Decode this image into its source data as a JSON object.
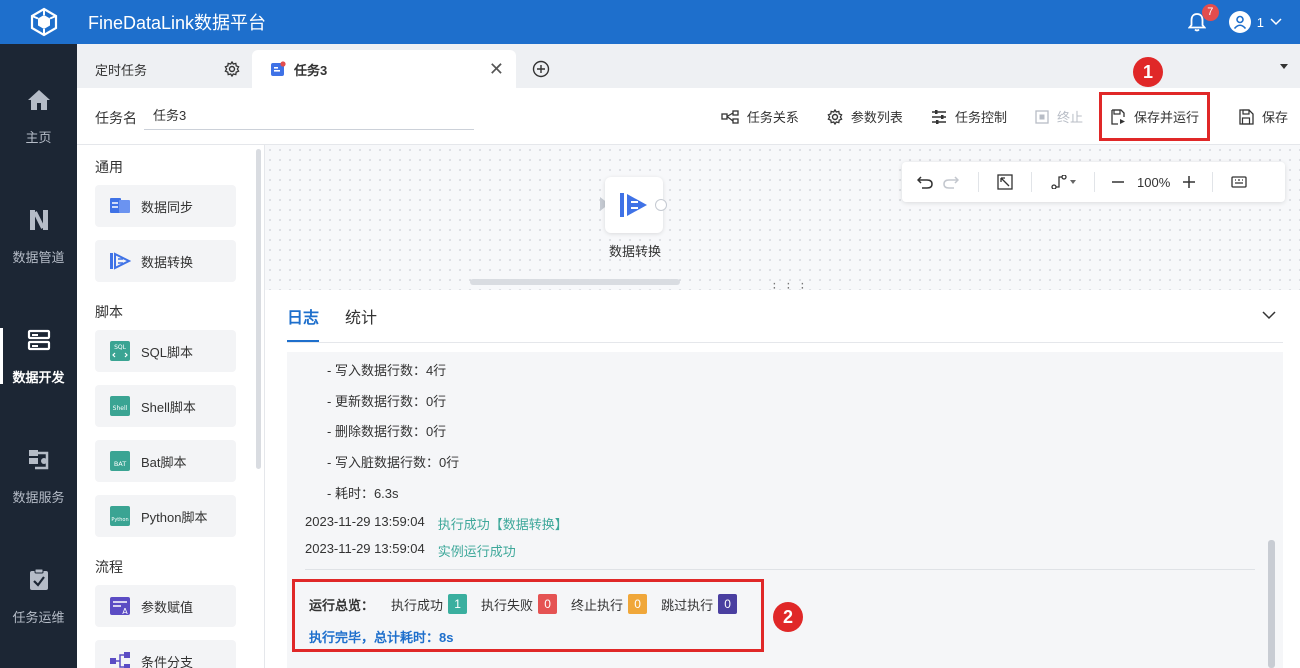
{
  "app": {
    "title": "FineDataLink数据平台"
  },
  "header": {
    "notifications_count": "7",
    "user_name": "1"
  },
  "sidebar": {
    "items": [
      {
        "label": "主页",
        "icon": "home-icon",
        "active": false
      },
      {
        "label": "数据管道",
        "icon": "pipeline-icon",
        "active": false
      },
      {
        "label": "数据开发",
        "icon": "dev-icon",
        "active": true
      },
      {
        "label": "数据服务",
        "icon": "service-icon",
        "active": false
      },
      {
        "label": "任务运维",
        "icon": "ops-icon",
        "active": false
      }
    ]
  },
  "tabs": [
    {
      "label": "定时任务",
      "icon": "gear-icon"
    },
    {
      "label": "任务3",
      "icon": "task-icon",
      "active": true
    }
  ],
  "task": {
    "label": "任务名",
    "name": "任务3"
  },
  "toolbar": {
    "relation": "任务关系",
    "params": "参数列表",
    "control": "任务控制",
    "stop": "终止",
    "save_run": "保存并运行",
    "save": "保存"
  },
  "components": {
    "groups": [
      {
        "title": "通用",
        "items": [
          "数据同步",
          "数据转换"
        ]
      },
      {
        "title": "脚本",
        "items": [
          "SQL脚本",
          "Shell脚本",
          "Bat脚本",
          "Python脚本"
        ]
      },
      {
        "title": "流程",
        "items": [
          "参数赋值",
          "条件分支"
        ]
      }
    ]
  },
  "canvas": {
    "node_label": "数据转换",
    "zoom": "100%"
  },
  "log": {
    "tabs": [
      "日志",
      "统计"
    ],
    "stats": [
      "- 写入数据行数：4行",
      "- 更新数据行数：0行",
      "- 删除数据行数：0行",
      "- 写入脏数据行数：0行",
      "- 耗时：6.3s"
    ],
    "lines": [
      {
        "time": "2023-11-29 13:59:04",
        "msg": "执行成功【数据转换】"
      },
      {
        "time": "2023-11-29 13:59:04",
        "msg": "实例运行成功"
      }
    ],
    "summary": {
      "title": "运行总览：",
      "items": [
        {
          "label": "执行成功",
          "count": "1",
          "color": "#3aaf9f"
        },
        {
          "label": "执行失败",
          "count": "0",
          "color": "#e55353"
        },
        {
          "label": "终止执行",
          "count": "0",
          "color": "#f0a73a"
        },
        {
          "label": "跳过执行",
          "count": "0",
          "color": "#4a3fa0"
        }
      ],
      "done": "执行完毕，总计耗时：8s"
    }
  },
  "markers": [
    "1",
    "2"
  ],
  "colors": {
    "brand": "#1e6fcc",
    "sidebar": "#1c2634",
    "highlight": "#e02828"
  }
}
